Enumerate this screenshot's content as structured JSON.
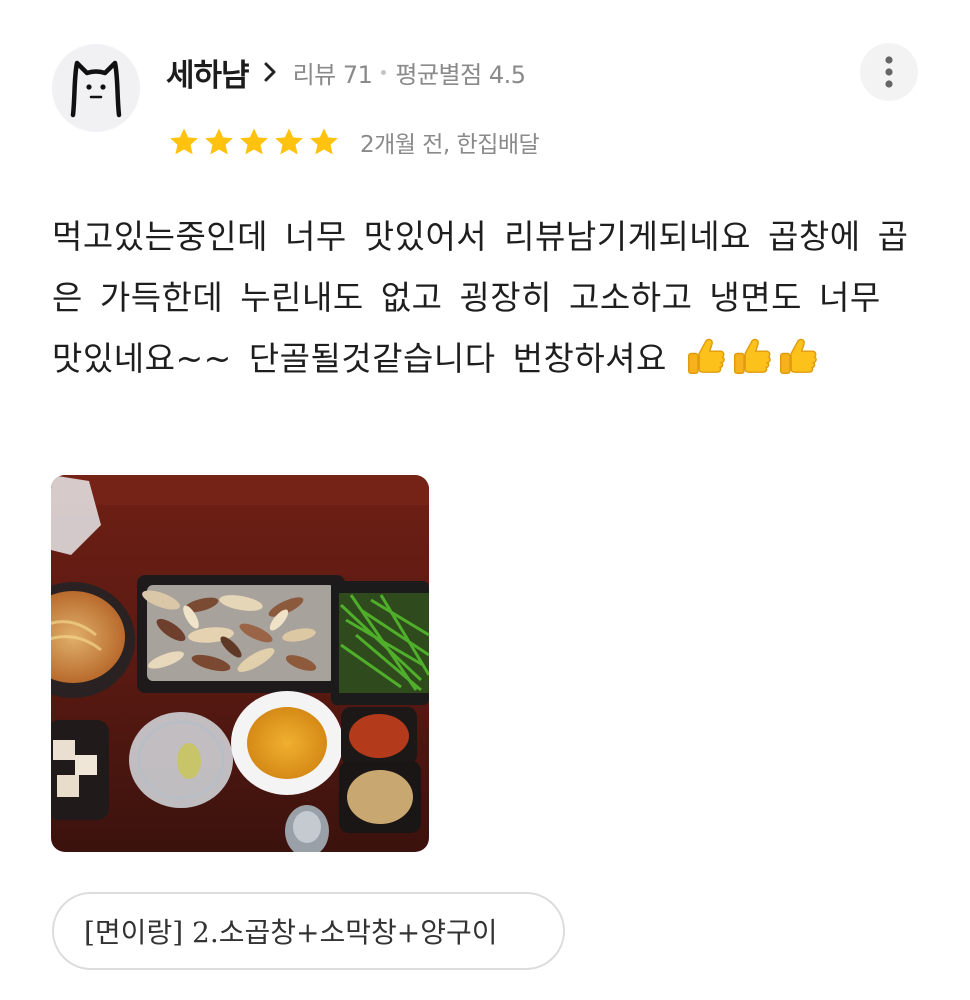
{
  "reviewer": {
    "nickname": "세하냠",
    "avatar_icon": "cat-face-icon",
    "review_count": "리뷰 71",
    "avg_rating": "평균별점 4.5"
  },
  "review": {
    "stars": 5,
    "star_color": "#ffc20e",
    "date_order": "2개월 전, 한집배달",
    "text": "먹고있는중인데 너무 맛있어서 리뷰남기게되네요 곱창에 곱은 가득한데 누린내도 없고 굉장히 고소하고 냉면도 너무 맛있네요~~ 단골될것같습니다 번창하셔요",
    "emoji_icon": "thumbs-up-icon",
    "emoji_count": 3,
    "photo_description": "food-photo"
  },
  "menu_chip": {
    "label": "[면이랑] 2.소곱창+소막창+양구이"
  },
  "actions": {
    "more_icon": "more-vertical-icon"
  }
}
